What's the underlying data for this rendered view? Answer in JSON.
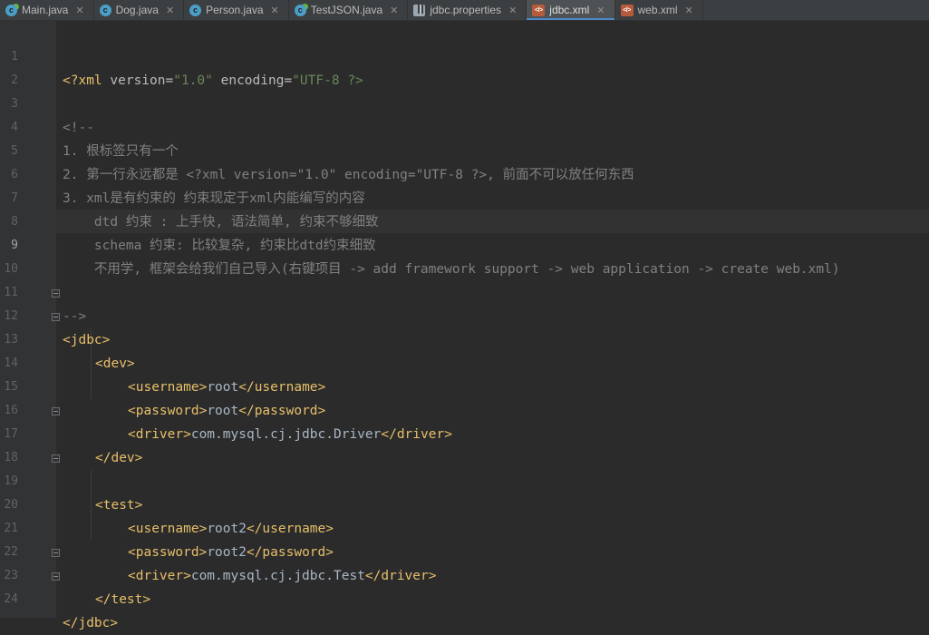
{
  "tabs": [
    {
      "label": "Main.java",
      "icon": "java-class-icon"
    },
    {
      "label": "Dog.java",
      "icon": "java-class-icon"
    },
    {
      "label": "Person.java",
      "icon": "java-class-icon"
    },
    {
      "label": "TestJSON.java",
      "icon": "java-class-icon"
    },
    {
      "label": "jdbc.properties",
      "icon": "properties-file-icon"
    },
    {
      "label": "jdbc.xml",
      "icon": "xml-file-icon",
      "active": true
    },
    {
      "label": "web.xml",
      "icon": "xml-file-icon"
    }
  ],
  "close_glyph": "✕",
  "colors": {
    "background": "#2b2b2b",
    "gutter": "#313335",
    "tag": "#e8bf6a",
    "string": "#6a8759",
    "comment": "#808080",
    "text": "#a9b7c6",
    "active_tab_underline": "#4a88c7"
  },
  "current_line": 9,
  "lines": {
    "n1": "1",
    "n2": "2",
    "n3": "3",
    "n4": "4",
    "n5": "5",
    "n6": "6",
    "n7": "7",
    "n8": "8",
    "n9": "9",
    "n10": "10",
    "n11": "11",
    "n12": "12",
    "n13": "13",
    "n14": "14",
    "n15": "15",
    "n16": "16",
    "n17": "17",
    "n18": "18",
    "n19": "19",
    "n20": "20",
    "n21": "21",
    "n22": "22",
    "n23": "23",
    "n24": "24"
  },
  "code": {
    "l1_open": "<?xml ",
    "l1_attr1": "version",
    "l1_eq1": "=",
    "l1_val1": "\"1.0\"",
    "l1_attr2": " encoding",
    "l1_eq2": "=",
    "l1_val2": "\"UTF-8 ?>",
    "l3": "<!--",
    "l4": "1. 根标签只有一个",
    "l5": "2. 第一行永远都是 <?xml version=\"1.0\" encoding=\"UTF-8 ?>, 前面不可以放任何东西",
    "l6": "3. xml是有约束的 约束现定于xml内能编写的内容",
    "l7": "    dtd 约束 : 上手快, 语法简单, 约束不够细致",
    "l8": "    schema 约束: 比较复杂, 约束比dtd约束细致",
    "l9": "    不用学, 框架会给我们自己导入(右键项目 -> add framework support -> web application -> create web.xml)",
    "l11": "-->",
    "l12": "<jdbc>",
    "l13": "<dev>",
    "l14_open": "<username>",
    "l14_text": "root",
    "l14_close": "</username>",
    "l15_open": "<password>",
    "l15_text": "root",
    "l15_close": "</password>",
    "l16_open": "<driver>",
    "l16_text": "com.mysql.cj.jdbc.Driver",
    "l16_close": "</driver>",
    "l17": "</dev>",
    "l19": "<test>",
    "l20_open": "<username>",
    "l20_text": "root2",
    "l20_close": "</username>",
    "l21_open": "<password>",
    "l21_text": "root2",
    "l21_close": "</password>",
    "l22_open": "<driver>",
    "l22_text": "com.mysql.cj.jdbc.Test",
    "l22_close": "</driver>",
    "l23": "</test>",
    "l24": "</jdbc>"
  }
}
